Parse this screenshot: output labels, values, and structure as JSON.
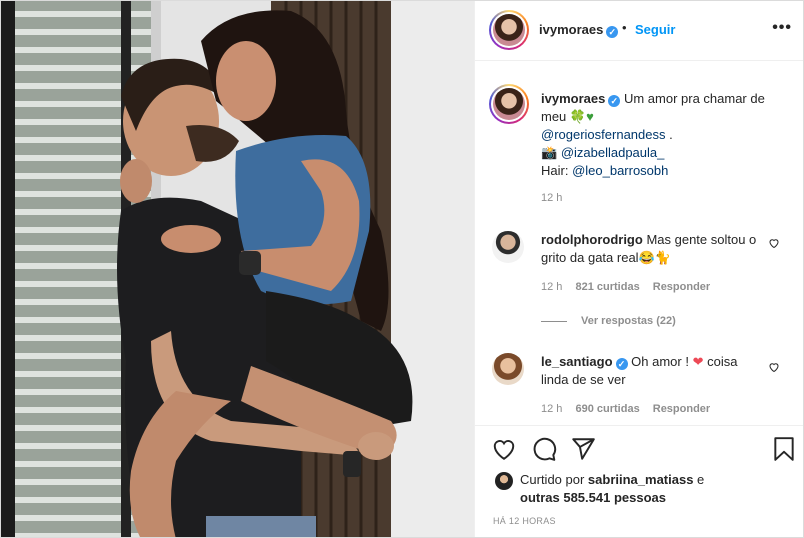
{
  "header": {
    "username": "ivymoraes",
    "separator": "•",
    "follow_label": "Seguir",
    "more_icon": "more-horizontal-icon"
  },
  "caption": {
    "username": "ivymoraes",
    "text_line1": "Um amor pra chamar de meu",
    "emoji": "🍀♥",
    "mention1": "@rogeriosfernandess",
    "mention1_suffix": " .",
    "camera_emoji": "📸",
    "mention2": "@izabelladpaula_",
    "hair_label": "Hair: ",
    "mention3": "@leo_barrosobh",
    "time": "12 h"
  },
  "comments": [
    {
      "username": "rodolphorodrigo",
      "text": "Mas gente soltou o grito da gata real😂🐈",
      "time": "12 h",
      "likes": "821 curtidas",
      "reply_label": "Responder"
    },
    {
      "username": "le_santiago",
      "text_before": "Oh amor ! ",
      "heart": "❤",
      "text_after": " coisa linda de se ver",
      "time": "12 h",
      "likes": "690 curtidas",
      "reply_label": "Responder"
    }
  ],
  "view_replies": "Ver respostas (22)",
  "likes": {
    "prefix": "Curtido por ",
    "user": "sabriina_matiass",
    "middle": " e",
    "others": "outras 585.541 pessoas"
  },
  "post_time": "HÁ 12 HORAS",
  "colors": {
    "accent": "#0095f6",
    "verified": "#3897f0",
    "text": "#262626",
    "muted": "#8e8e8e",
    "link": "#00376b"
  }
}
